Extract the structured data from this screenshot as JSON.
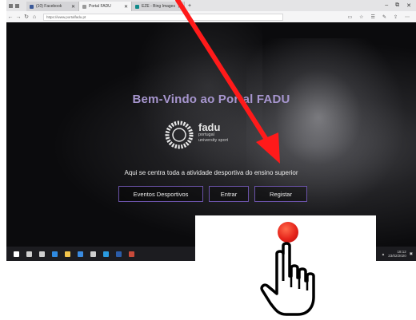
{
  "browser": {
    "tabs": [
      {
        "label": "(10) Facebook",
        "icon": "facebook-icon",
        "color": "#3b5998"
      },
      {
        "label": "Portal FADU",
        "icon": "page-icon",
        "color": "#9a9a9a"
      },
      {
        "label": "EZE - Bing Images",
        "icon": "bing-icon",
        "color": "#0f8a8a"
      }
    ],
    "url": "https://www.portalfadu.pt",
    "new_tab": "+",
    "window_controls": [
      "–",
      "⧉",
      "✕"
    ]
  },
  "page": {
    "welcome": "Bem-Vindo ao Portal FADU",
    "logo": {
      "brand": "fadu",
      "line1": "portugal",
      "line2": "university sport"
    },
    "tagline": "Aqui se centra toda a atividade desportiva do ensino superior",
    "buttons": {
      "events": "Eventos Desportivos",
      "login": "Entrar",
      "register": "Registar"
    }
  },
  "taskbar": {
    "apps": [
      {
        "name": "start-icon",
        "color": "#ffffff"
      },
      {
        "name": "search-icon",
        "color": "#cfcfcf"
      },
      {
        "name": "task-view-icon",
        "color": "#cfcfcf"
      },
      {
        "name": "edge-icon",
        "color": "#2f8ae0"
      },
      {
        "name": "file-explorer-icon",
        "color": "#f2c44b"
      },
      {
        "name": "store-icon",
        "color": "#3a8be0"
      },
      {
        "name": "mail-icon",
        "color": "#cfcfcf"
      },
      {
        "name": "ie-icon",
        "color": "#2a9be0"
      },
      {
        "name": "word-icon",
        "color": "#2b5ca8"
      },
      {
        "name": "app-icon",
        "color": "#c84a3a"
      }
    ],
    "time": "18:12",
    "date": "23/02/2020"
  },
  "colors": {
    "accent_purple": "#6a52a8",
    "welcome_text": "#a796cf",
    "arrow_red": "#ff1a1a"
  }
}
